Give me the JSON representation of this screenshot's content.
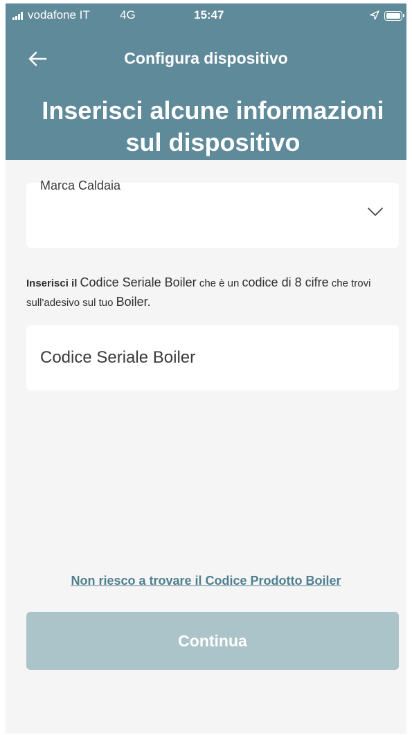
{
  "status_bar": {
    "carrier": "vodafone IT",
    "network": "4G",
    "time": "15:47"
  },
  "header": {
    "nav_title": "Configura dispositivo",
    "title_line1": "Inserisci alcune informazioni",
    "title_line2": "sul dispositivo"
  },
  "brand_select": {
    "label": "Marca Caldaia",
    "value": ""
  },
  "instructions": {
    "part1": "Inserisci il",
    "part2": "Codice Seriale Boiler",
    "part3": "che è un",
    "part4": "codice di 8 cifre",
    "part5": "che trovi sull'adesivo sul tuo",
    "part6": "Boiler."
  },
  "serial_input": {
    "placeholder": "Codice Seriale Boiler",
    "value": ""
  },
  "help_link": "Non riesco a trovare il Codice Prodotto Boiler",
  "continue_label": "Continua",
  "colors": {
    "header_bg": "#5f8a9a",
    "screen_bg": "#f5f5f5",
    "link": "#4f7f8f",
    "button_disabled": "#abc4c9"
  }
}
